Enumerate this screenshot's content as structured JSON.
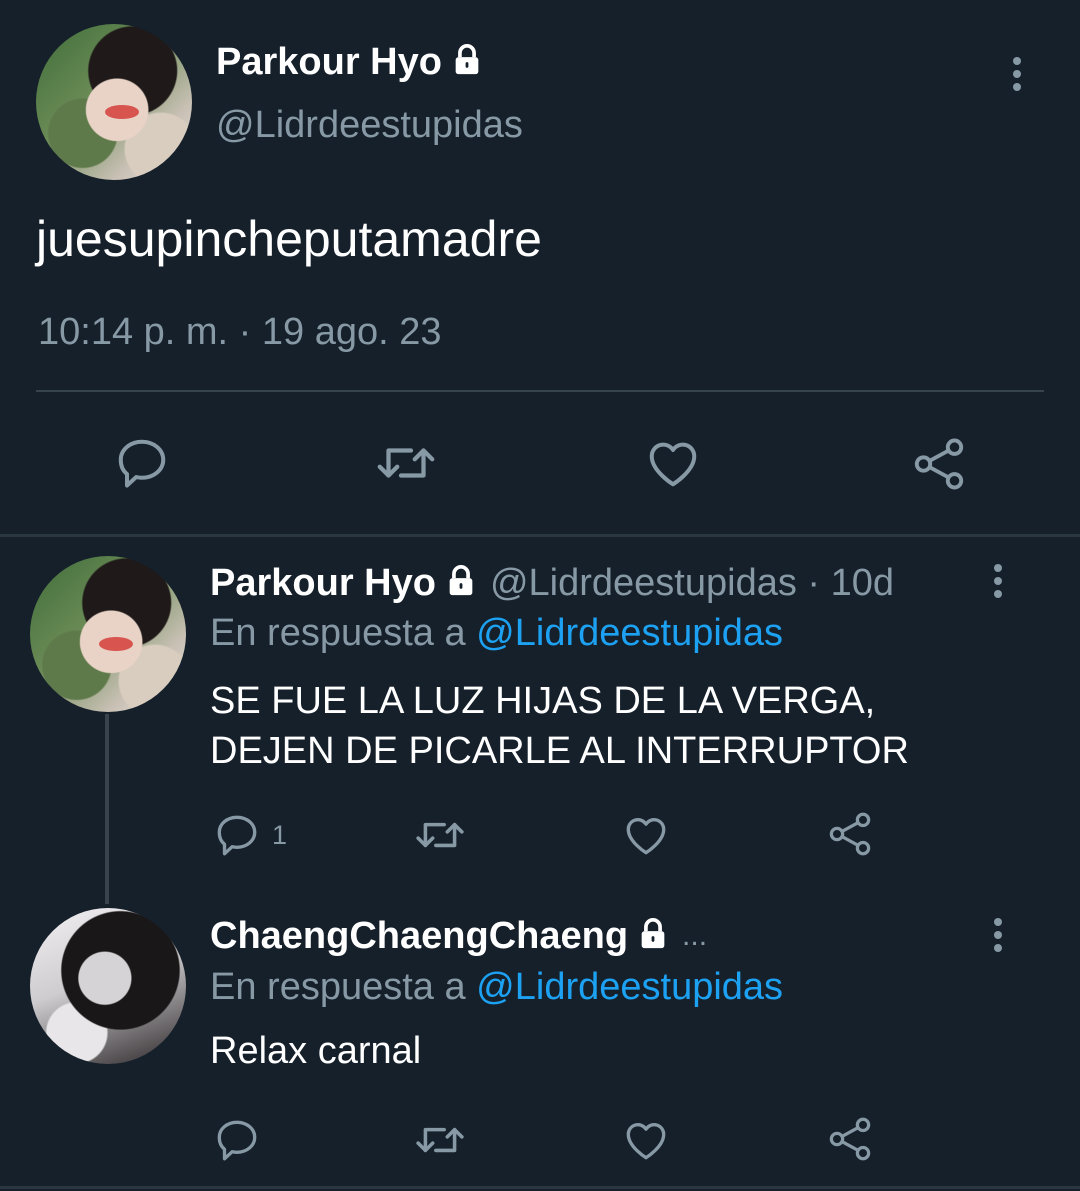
{
  "main_tweet": {
    "display_name": "Parkour Hyo",
    "handle": "@Lidrdeestupidas",
    "text": "juesupincheputamadre",
    "timestamp": "10:14 p. m. · 19 ago. 23"
  },
  "reply_1": {
    "display_name": "Parkour Hyo",
    "handle_time": "@Lidrdeestupidas · 10d",
    "reply_prefix": "En respuesta a ",
    "reply_to": "@Lidrdeestupidas",
    "text_line1": "SE FUE LA LUZ HIJAS DE LA VERGA,",
    "text_line2": "DEJEN DE PICARLE AL INTERRUPTOR",
    "reply_count": "1"
  },
  "reply_2": {
    "display_name": "ChaengChaengChaeng",
    "truncation": "...",
    "reply_prefix": "En respuesta a ",
    "reply_to": "@Lidrdeestupidas",
    "text": "Relax carnal"
  },
  "colors": {
    "background": "#15202b",
    "text_primary": "#ffffff",
    "text_muted": "#8899a6",
    "link": "#1da1f2",
    "divider": "#38444d"
  }
}
